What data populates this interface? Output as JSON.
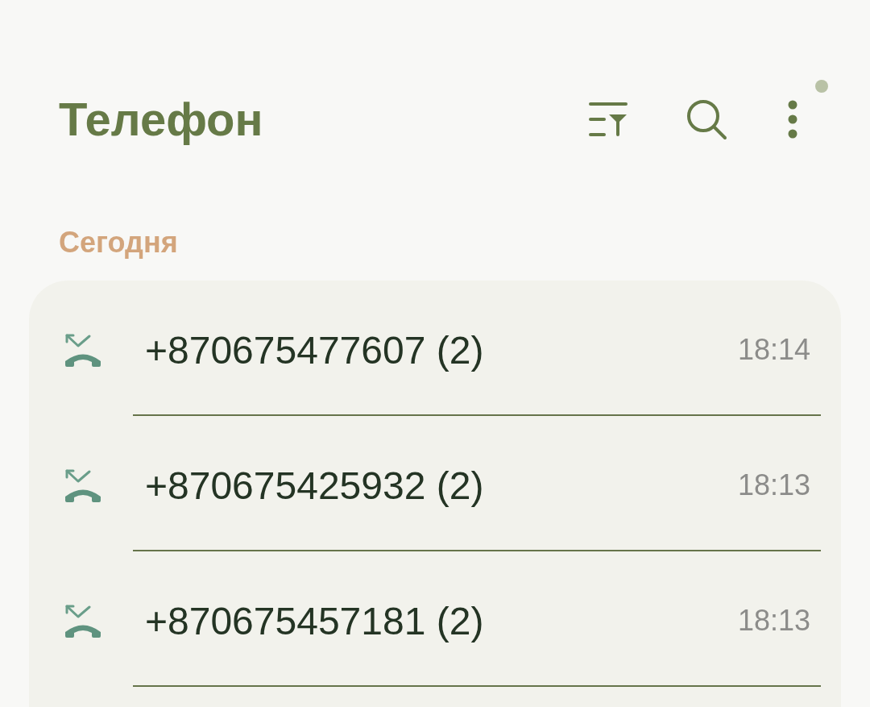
{
  "app_bar": {
    "title": "Телефон",
    "notification_dot": true
  },
  "sections": [
    {
      "label": "Сегодня",
      "calls": [
        {
          "number": "+870675477607 (2)",
          "time": "18:14"
        },
        {
          "number": "+870675425932 (2)",
          "time": "18:13"
        },
        {
          "number": "+870675457181 (2)",
          "time": "18:13"
        }
      ]
    }
  ]
}
